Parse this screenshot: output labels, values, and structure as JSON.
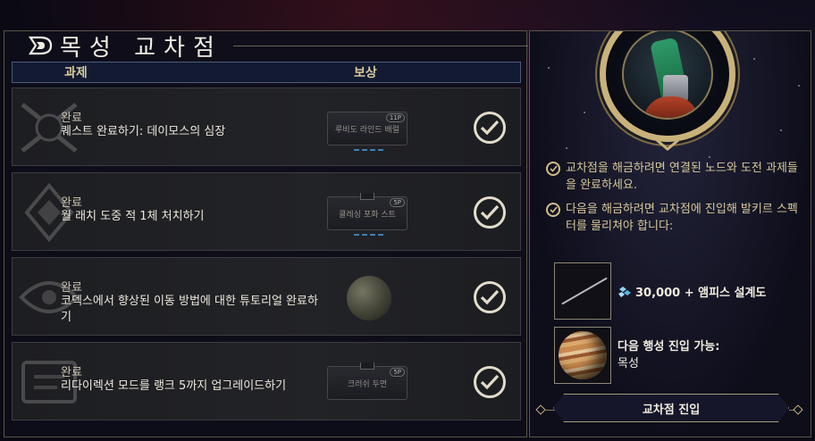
{
  "title": "목성 교차점",
  "headers": {
    "task": "과제",
    "reward": "보상"
  },
  "tasks": [
    {
      "status": "완료",
      "desc": "퀘스트 완료하기: 데이모스의 심장",
      "reward_label": "루비도 라인드 배럴",
      "reward_tag": "11P"
    },
    {
      "status": "완료",
      "desc": "월 래치 도중 적 1체 처치하기",
      "reward_label": "클레싱 포화 스트",
      "reward_tag": "5P"
    },
    {
      "status": "완료",
      "desc": "코덱스에서 향상된 이동 방법에 대한 튜토리얼 완료하기",
      "reward_label": "",
      "reward_tag": ""
    },
    {
      "status": "완료",
      "desc": "리다이렉션 모드를 랭크 5까지 업그레이드하기",
      "reward_label": "크러쉬 두먼",
      "reward_tag": "5P"
    }
  ],
  "info": [
    "교차점을 해금하려면 연결된 노드와 도전 과제들을 완료하세요.",
    "다음을 해금하려면 교차점에 진입해 발키르 스펙터를 물리쳐야 합니다:"
  ],
  "rewards": {
    "credits": "30,000 + 앰피스 설계도",
    "next_planet_label": "다음 행성 진입 가능:",
    "next_planet": "목성"
  },
  "enter_button": "교차점 진입",
  "colors": {
    "accent_gold": "#c9b27a",
    "header_blue": "#131b33",
    "text_gold": "#d8c79a"
  }
}
